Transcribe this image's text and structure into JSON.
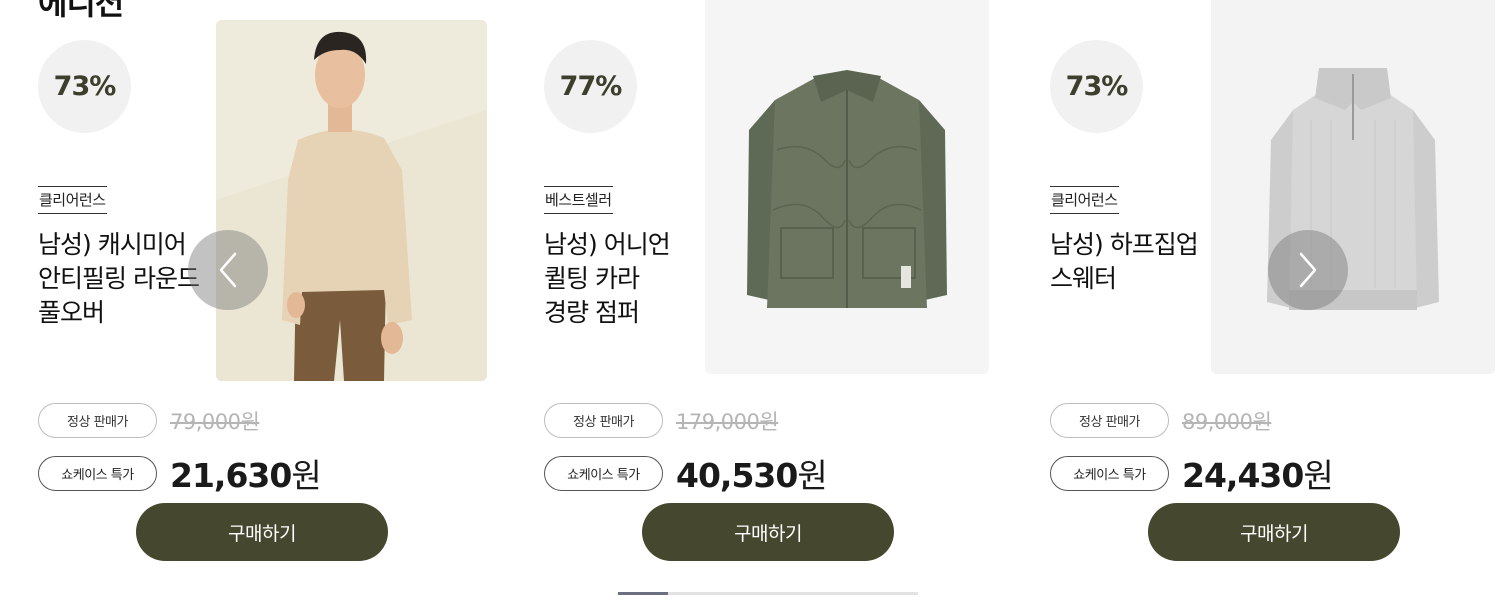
{
  "section": {
    "title": "에디션"
  },
  "products": [
    {
      "discount": "73%",
      "brand": "클리어런스",
      "name": [
        "남성) 캐시미어",
        "안티필링 라운드",
        "풀오버"
      ],
      "regular_tag": "정상 판매가",
      "regular_price": "79,000원",
      "special_tag": "쇼케이스 특가",
      "sale_amount": "21,630",
      "sale_unit": "원",
      "buy_label": "구매하기",
      "image": "man-in-beige-sweater-photo"
    },
    {
      "discount": "77%",
      "brand": "베스트셀러",
      "name": [
        "남성) 어니언",
        "퀼팅 카라",
        "경량 점퍼"
      ],
      "regular_tag": "정상 판매가",
      "regular_price": "179,000원",
      "special_tag": "쇼케이스 특가",
      "sale_amount": "40,530",
      "sale_unit": "원",
      "buy_label": "구매하기",
      "image": "olive-quilted-jacket"
    },
    {
      "discount": "73%",
      "brand": "클리어런스",
      "name": [
        "남성) 하프집업",
        "스웨터"
      ],
      "regular_tag": "정상 판매가",
      "regular_price": "89,000원",
      "special_tag": "쇼케이스 특가",
      "sale_amount": "24,430",
      "sale_unit": "원",
      "buy_label": "구매하기",
      "image": "grey-half-zip-sweater"
    }
  ],
  "navigation": {
    "prev_icon": "chevron-left-icon",
    "next_icon": "chevron-right-icon"
  },
  "carousel": {
    "progress_fraction": 0.167
  },
  "colors": {
    "accent": "#46472f",
    "discount_text": "#3d3f2c",
    "discount_bg": "#f1f1f1"
  }
}
